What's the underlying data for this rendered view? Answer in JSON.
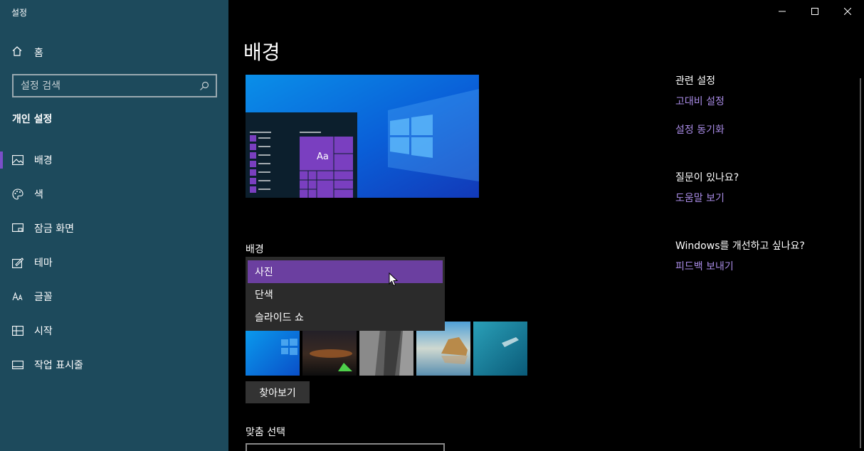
{
  "window": {
    "title": "설정"
  },
  "sidebar": {
    "home_label": "홈",
    "search_placeholder": "설정 검색",
    "section_title": "개인 설정",
    "items": [
      {
        "label": "배경",
        "icon": "image-icon",
        "selected": true
      },
      {
        "label": "색",
        "icon": "palette-icon",
        "selected": false
      },
      {
        "label": "잠금 화면",
        "icon": "lock-screen-icon",
        "selected": false
      },
      {
        "label": "테마",
        "icon": "theme-icon",
        "selected": false
      },
      {
        "label": "글꼴",
        "icon": "font-icon",
        "selected": false
      },
      {
        "label": "시작",
        "icon": "start-icon",
        "selected": false
      },
      {
        "label": "작업 표시줄",
        "icon": "taskbar-icon",
        "selected": false
      }
    ]
  },
  "main": {
    "title": "배경",
    "preview_tile_text": "Aa",
    "background_label": "배경",
    "dropdown_options": [
      "사진",
      "단색",
      "슬라이드 쇼"
    ],
    "dropdown_selected": "사진",
    "browse_label": "찾아보기",
    "fit_label": "맞춤 선택"
  },
  "related": {
    "heading": "관련 설정",
    "links": [
      "고대비 설정",
      "설정 동기화"
    ],
    "help_heading": "질문이 있나요?",
    "help_link": "도움말 보기",
    "feedback_heading": "Windows를 개선하고 싶나요?",
    "feedback_link": "피드백 보내기"
  },
  "colors": {
    "sidebar_bg": "#1d4a5c",
    "accent": "#7b4fc9",
    "link": "#a98be6",
    "dropdown_selected": "#6b3fa0"
  }
}
